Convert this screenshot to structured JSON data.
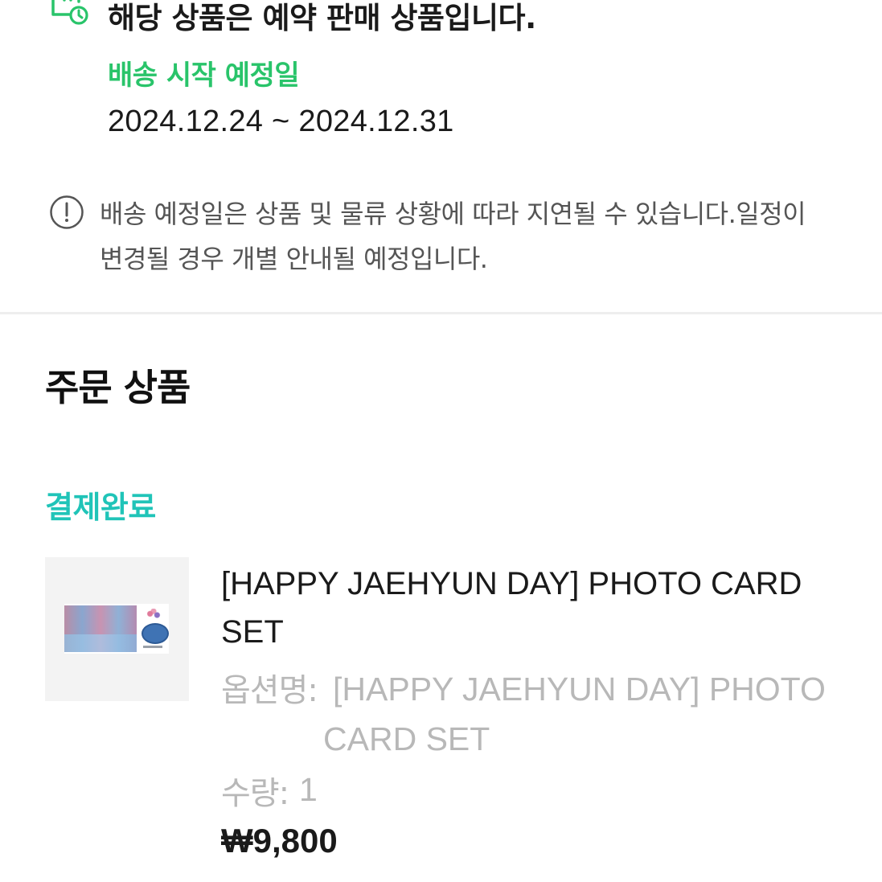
{
  "preorder_notice": {
    "icon": "calendar-clock-icon",
    "title": "해당 상품은 예약 판매 상품입니다.",
    "shipping_label": "배송 시작 예정일",
    "shipping_dates": "2024.12.24 ~ 2024.12.31"
  },
  "info": {
    "icon": "info-circle-icon",
    "text": "배송 예정일은 상품 및 물류 상황에 따라 지연될 수 있습니다.일정이 변경될 경우 개별 안내될 예정입니다."
  },
  "order_section": {
    "title": "주문 상품",
    "status": "결제완료",
    "product": {
      "thumbnail": "photo-card-set-thumbnail",
      "name": "[HAPPY JAEHYUN DAY] PHOTO CARD SET",
      "option_label": "옵션명:",
      "option_value": "[HAPPY JAEHYUN DAY] PHOTO CARD SET",
      "quantity_label": "수량:",
      "quantity_value": "1",
      "price": "₩9,800"
    }
  },
  "colors": {
    "accent_green": "#29c46a",
    "status_teal": "#20c4b8",
    "muted_gray": "#b8b8b8"
  }
}
